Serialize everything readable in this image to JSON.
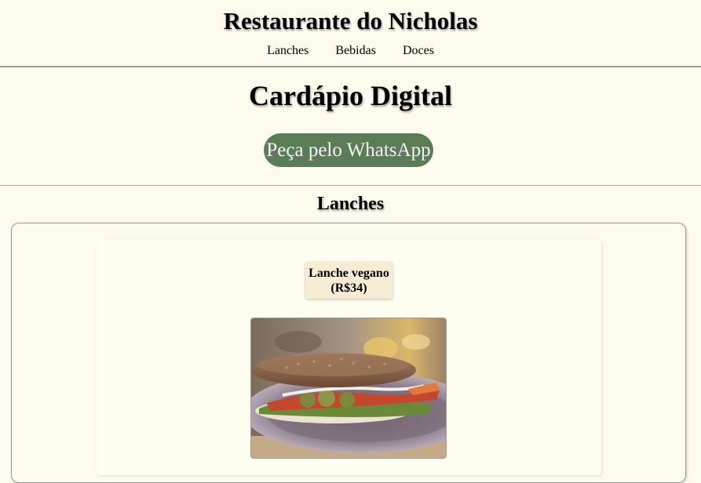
{
  "header": {
    "title": "Restaurante do Nicholas",
    "nav": [
      "Lanches",
      "Bebidas",
      "Doces"
    ]
  },
  "main": {
    "heading": "Cardápio Digital",
    "whatsapp_button": "Peça pelo WhatsApp"
  },
  "sections": [
    {
      "title": "Lanches",
      "items": [
        {
          "name": "Lanche vegano",
          "price": "(R$34)",
          "image": "vegan-sandwich-photo"
        }
      ]
    }
  ],
  "colors": {
    "background": "#fefaed",
    "button": "#5a7d57",
    "label_background": "#f5edd3"
  }
}
